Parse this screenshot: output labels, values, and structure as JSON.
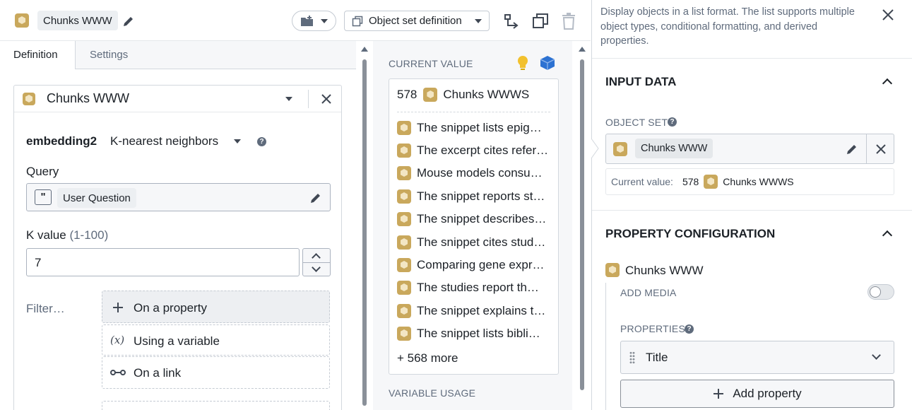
{
  "header": {
    "object_name": "Chunks WWW",
    "object_set_definition_label": "Object set definition"
  },
  "tabs": [
    {
      "label": "Definition",
      "active": true
    },
    {
      "label": "Settings",
      "active": false
    }
  ],
  "definition": {
    "object_type": "Chunks WWW",
    "embedding_property": "embedding2",
    "search_mode": "K-nearest neighbors",
    "query_label": "Query",
    "query_value": "User Question",
    "k_label": "K value",
    "k_range": "(1-100)",
    "k_value": "7",
    "filter_label": "Filter…",
    "filter_options": [
      {
        "label": "On a property",
        "icon": "plus-icon"
      },
      {
        "label": "Using a variable",
        "icon": "variable-icon"
      },
      {
        "label": "On a link",
        "icon": "link-icon"
      }
    ]
  },
  "current_value": {
    "heading": "CURRENT VALUE",
    "count": "578",
    "object_type": "Chunks WWWS",
    "items": [
      "The snippet lists epig…",
      "The excerpt cites refer…",
      "Mouse models consu…",
      "The snippet reports st…",
      "The snippet describes…",
      "The snippet cites stud…",
      "Comparing gene expr…",
      "The studies report th…",
      "The snippet explains t…",
      "The snippet lists bibli…"
    ],
    "more": "+ 568 more",
    "variable_usage": "VARIABLE USAGE"
  },
  "right_panel": {
    "description": "Display objects in a list format. The list supports multiple object types, conditional formatting, and derived properties.",
    "input_data_title": "INPUT DATA",
    "object_set_label": "OBJECT SET",
    "object_set_value": "Chunks WWW",
    "current_value_label": "Current value:",
    "current_value_count": "578",
    "current_value_type": "Chunks WWWS",
    "property_config_title": "PROPERTY CONFIGURATION",
    "object_type": "Chunks WWW",
    "add_media_label": "ADD MEDIA",
    "add_media_enabled": false,
    "properties_label": "PROPERTIES",
    "property_selected": "Title",
    "add_property_label": "Add property"
  },
  "colors": {
    "object_icon": "#c9a85c",
    "lightbulb": "#f2c12e",
    "cube_blue": "#2d72d2"
  }
}
